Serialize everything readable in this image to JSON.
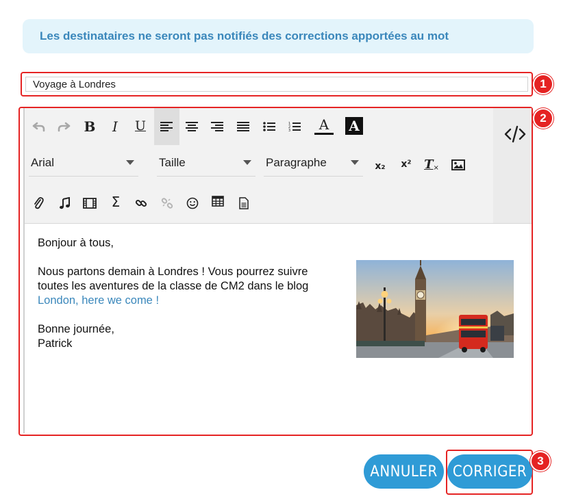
{
  "notice": {
    "text": "Les destinataires ne seront pas notifiés des corrections apportées au mot"
  },
  "subject": {
    "value": "Voyage à Londres"
  },
  "badges": {
    "one": "1",
    "two": "2",
    "three": "3"
  },
  "toolbar": {
    "row1": [
      "undo-icon",
      "redo-icon",
      "bold-icon",
      "italic-icon",
      "underline-icon",
      "align-left-icon",
      "align-center-icon",
      "align-right-icon",
      "align-justify-icon",
      "bullet-list-icon",
      "numbered-list-icon",
      "text-color-icon",
      "background-color-icon"
    ],
    "font": "Arial",
    "size": "Taille",
    "format": "Paragraphe",
    "row2": [
      "subscript-icon",
      "superscript-icon",
      "clear-format-icon",
      "image-icon"
    ],
    "row3": [
      "attachment-icon",
      "music-icon",
      "film-icon",
      "sigma-icon",
      "link-icon",
      "unlink-icon",
      "emoji-icon",
      "table-icon",
      "template-icon"
    ],
    "code_view": "code-view-icon",
    "labels": {
      "bold": "B",
      "italic": "I",
      "underline": "U",
      "text_color": "A",
      "background_color": "A",
      "subscript": "x₂",
      "superscript": "x²",
      "clear": "T",
      "sigma": "Σ"
    }
  },
  "content": {
    "greeting": "Bonjour à tous,",
    "line1": "Nous partons demain à Londres ! Vous pourrez suivre",
    "line2": "toutes les aventures de la classe de CM2 dans le blog",
    "link": "London, here we come !",
    "closing": "Bonne journée,",
    "signature": "Patrick"
  },
  "buttons": {
    "cancel": "ANNULER",
    "submit": "CORRIGER"
  },
  "colors": {
    "accent": "#2f9bd6",
    "highlight": "#e52323",
    "notice_bg": "#e3f4fb",
    "notice_text": "#3a87bb"
  }
}
